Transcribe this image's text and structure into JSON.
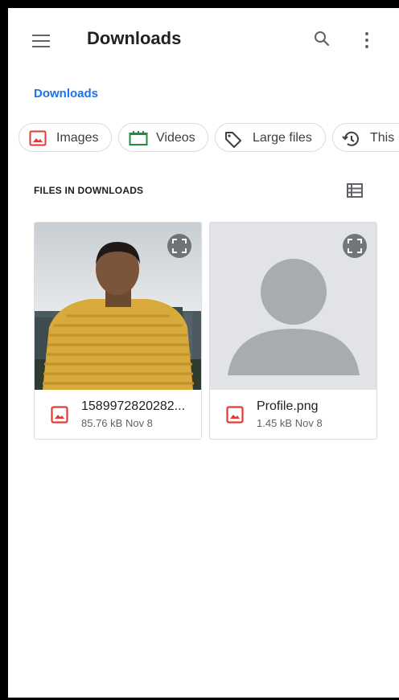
{
  "appbar": {
    "title": "Downloads",
    "menu_icon": "hamburger-menu-icon",
    "search_icon": "search-icon",
    "more_icon": "more-vert-icon"
  },
  "breadcrumb": {
    "label": "Downloads"
  },
  "chips": [
    {
      "label": "Images",
      "icon": "image-icon",
      "color": "#e53935"
    },
    {
      "label": "Videos",
      "icon": "video-clapper-icon",
      "color": "#1e8e3e"
    },
    {
      "label": "Large files",
      "icon": "tag-icon",
      "color": "#3c4043"
    },
    {
      "label": "This",
      "icon": "history-icon",
      "color": "#3c4043"
    }
  ],
  "section": {
    "title": "FILES IN DOWNLOADS",
    "view_icon": "list-view-icon"
  },
  "files": [
    {
      "name": "1589972820282...",
      "size": "85.76 kB",
      "date": "Nov 8",
      "type_icon": "image-file-icon",
      "thumb": "photo"
    },
    {
      "name": "Profile.png",
      "size": "1.45 kB",
      "date": "Nov 8",
      "type_icon": "image-file-icon",
      "thumb": "avatar-placeholder"
    }
  ],
  "colors": {
    "accent": "#1a73e8",
    "image_red": "#e53935",
    "video_green": "#1e8e3e"
  }
}
